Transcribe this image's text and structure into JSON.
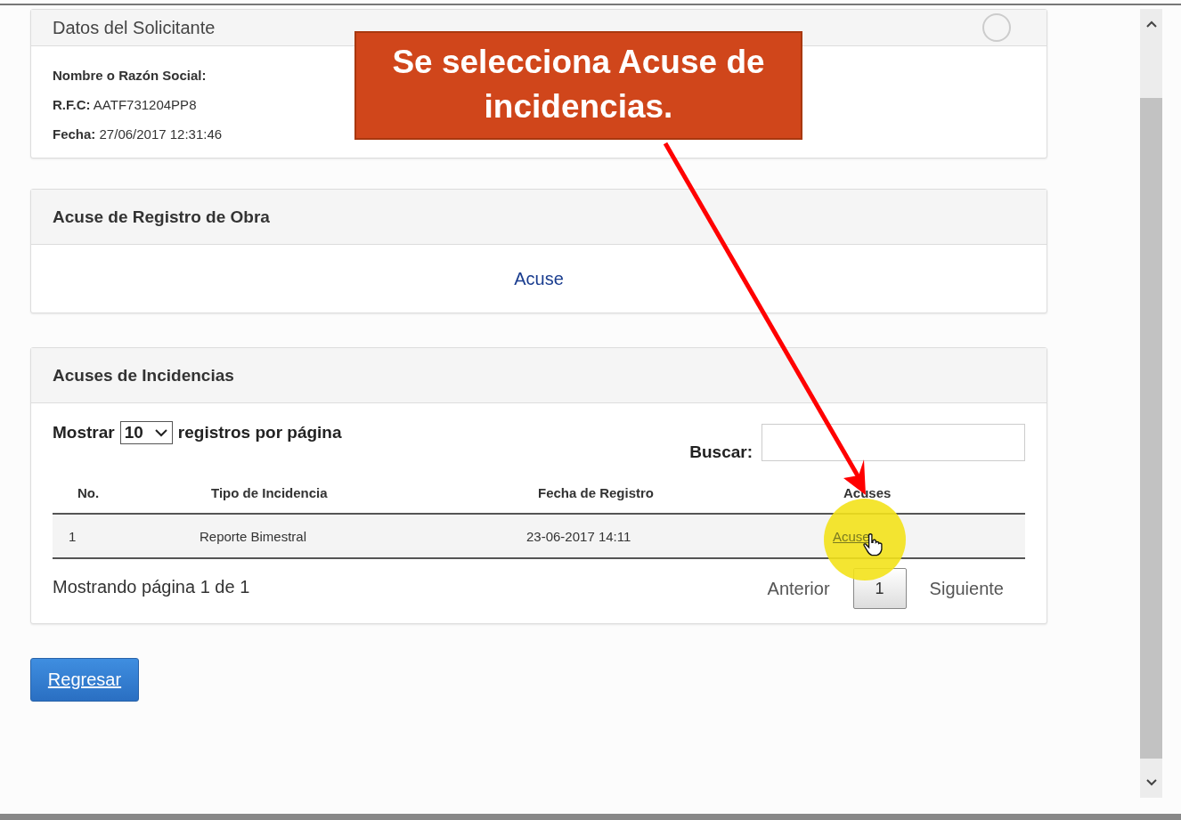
{
  "solicitante": {
    "title": "Datos del Solicitante",
    "fields": [
      {
        "label": "Nombre o Razón Social:"
      },
      {
        "label": "R.F.C:",
        "value": "AATF731204PP8"
      },
      {
        "label": "Fecha:",
        "value": "27/06/2017 12:31:46"
      }
    ]
  },
  "registro_obra": {
    "title": "Acuse de Registro de Obra",
    "link": "Acuse"
  },
  "incidencias": {
    "title": "Acuses de Incidencias",
    "length_before": "Mostrar",
    "length_value": "10",
    "length_after": "registros por página",
    "search_label": "Buscar:",
    "columns": [
      "No.",
      "Tipo de Incidencia",
      "Fecha de Registro",
      "Acuses"
    ],
    "rows": [
      {
        "no": "1",
        "tipo": "Reporte Bimestral",
        "fecha": "23-06-2017 14:11",
        "acuse": "Acuse",
        "hovered": true
      }
    ],
    "info": "Mostrando página 1 de 1",
    "prev": "Anterior",
    "pages": [
      {
        "label": "1",
        "selected": true
      }
    ],
    "next": "Siguiente"
  },
  "back_button": "Regresar",
  "callout": "Se selecciona Acuse de incidencias."
}
